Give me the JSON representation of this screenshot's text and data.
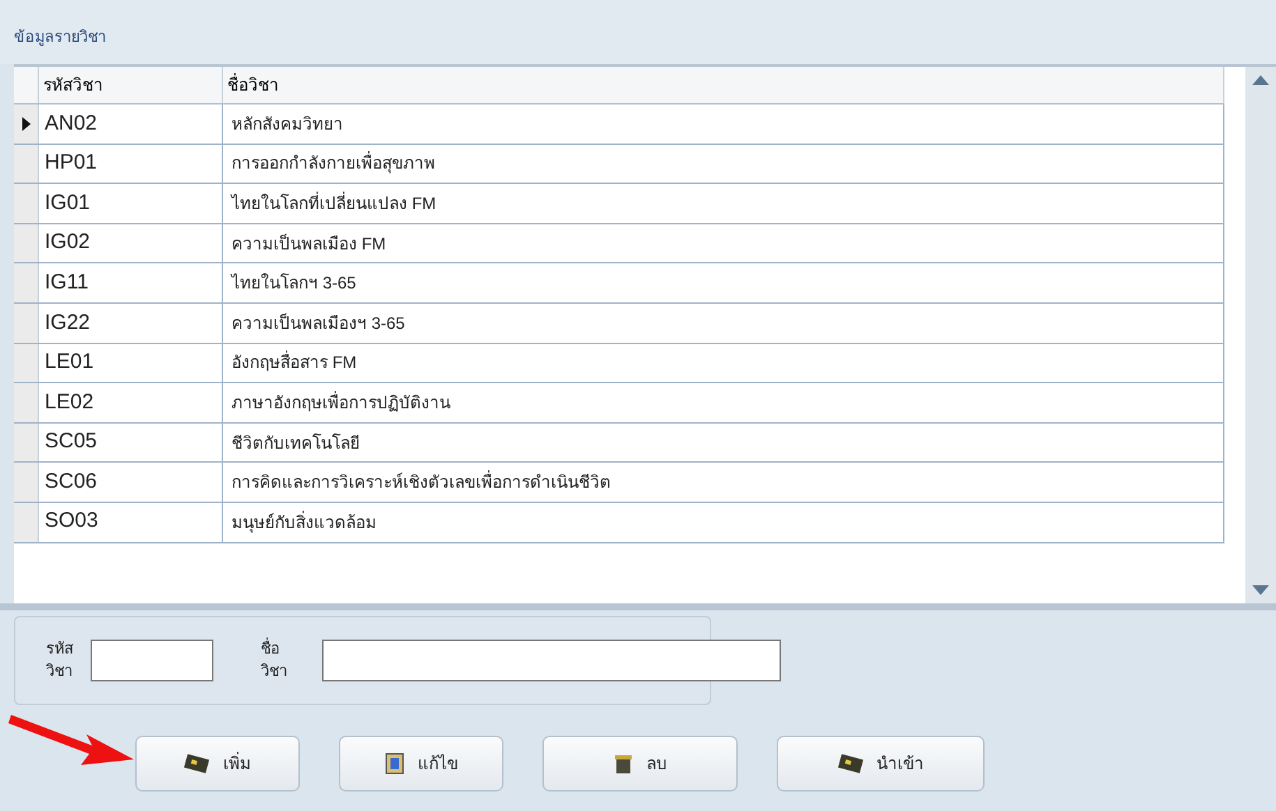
{
  "panel_title": "ข้อมูลรายวิชา",
  "table": {
    "columns": [
      "รหัสวิชา",
      "ชื่อวิชา"
    ],
    "rows": [
      {
        "code": "AN02",
        "name": "หลักสังคมวิทยา",
        "selected": true
      },
      {
        "code": "HP01",
        "name": "การออกกำลังกายเพื่อสุขภาพ",
        "selected": false
      },
      {
        "code": "IG01",
        "name": "ไทยในโลกที่เปลี่ยนแปลง FM",
        "selected": false
      },
      {
        "code": "IG02",
        "name": "ความเป็นพลเมือง FM",
        "selected": false
      },
      {
        "code": "IG11",
        "name": "ไทยในโลกฯ 3-65",
        "selected": false
      },
      {
        "code": "IG22",
        "name": "ความเป็นพลเมืองฯ 3-65",
        "selected": false
      },
      {
        "code": "LE01",
        "name": "อังกฤษสื่อสาร FM",
        "selected": false
      },
      {
        "code": "LE02",
        "name": "ภาษาอังกฤษเพื่อการปฏิบัติงาน",
        "selected": false
      },
      {
        "code": "SC05",
        "name": "ชีวิตกับเทคโนโลยี",
        "selected": false
      },
      {
        "code": "SC06",
        "name": "การคิดและการวิเคราะห์เชิงตัวเลขเพื่อการดำเนินชีวิต",
        "selected": false
      },
      {
        "code": "SO03",
        "name": "มนุษย์กับสิ่งแวดล้อม",
        "selected": false
      }
    ]
  },
  "form": {
    "fields": [
      {
        "label": "รหัสวิชา",
        "kind": "short"
      },
      {
        "label": "ชื่อวิชา",
        "kind": "long"
      }
    ]
  },
  "buttons": [
    {
      "label": "เพิ่ม",
      "kind": "add"
    },
    {
      "label": "แก้ไข",
      "kind": "edit"
    },
    {
      "label": "ลบ",
      "kind": "delete"
    },
    {
      "label": "นำเข้า",
      "kind": "import"
    }
  ]
}
